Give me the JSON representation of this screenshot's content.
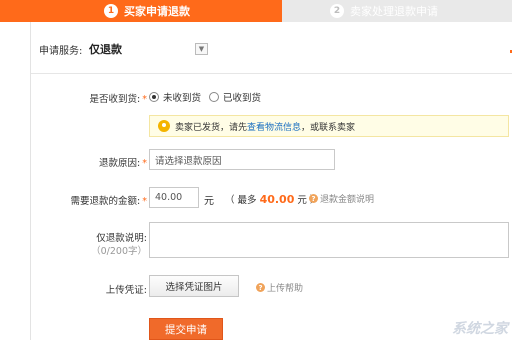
{
  "steps": [
    {
      "num": "1",
      "label": "买家申请退款",
      "active": true
    },
    {
      "num": "2",
      "label": "卖家处理退款申请",
      "active": false
    }
  ],
  "service": {
    "label": "申请服务:",
    "value": "仅退款",
    "dropdown_icon": "chevron-down-icon"
  },
  "received": {
    "label": "是否收到货:",
    "required": "*",
    "options": [
      {
        "label": "未收到货",
        "checked": true
      },
      {
        "label": "已收到货",
        "checked": false
      }
    ]
  },
  "tip": {
    "prefix": "卖家已发货，请先",
    "link": "查看物流信息",
    "suffix": "，或联系卖家"
  },
  "reason": {
    "label": "退款原因:",
    "required": "*",
    "placeholder": "请选择退款原因"
  },
  "amount": {
    "label": "需要退款的金额:",
    "required": "*",
    "value": "40.00",
    "unit": "元",
    "max_prefix": "（ 最多",
    "max_value": "40.00",
    "max_suffix": "元 ）",
    "help": "退款金额说明"
  },
  "description": {
    "label": "仅退款说明:",
    "counter": "（0/200字）"
  },
  "voucher": {
    "label": "上传凭证:",
    "button": "选择凭证图片",
    "help": "上传帮助"
  },
  "submit": {
    "label": "提交申请"
  },
  "watermark": "系统之家",
  "colors": {
    "accent": "#ff6a1a",
    "link": "#1a6fc1",
    "tip_bg": "#fffde6"
  }
}
